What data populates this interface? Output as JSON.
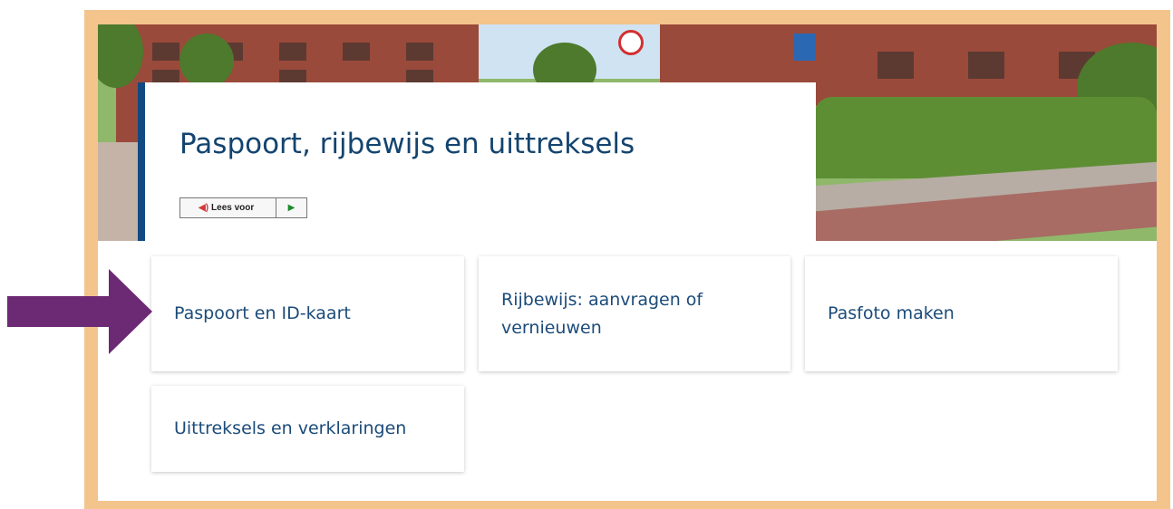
{
  "page": {
    "title": "Paspoort, rijbewijs en uittreksels"
  },
  "readspeaker": {
    "listen_label": "Lees voor",
    "speaker_icon": "speaker-icon",
    "play_icon": "play-icon"
  },
  "cards": [
    {
      "label": "Paspoort en ID-kaart"
    },
    {
      "label": "Rijbewijs: aanvragen of vernieuwen"
    },
    {
      "label": "Pasfoto maken"
    },
    {
      "label": "Uittreksels en verklaringen"
    }
  ],
  "annotation": {
    "arrow_icon": "pointer-arrow-icon",
    "arrow_color": "#6b2a73"
  },
  "colors": {
    "frame": "#f3c48c",
    "accent": "#114a80",
    "link_text": "#1b4b79"
  }
}
